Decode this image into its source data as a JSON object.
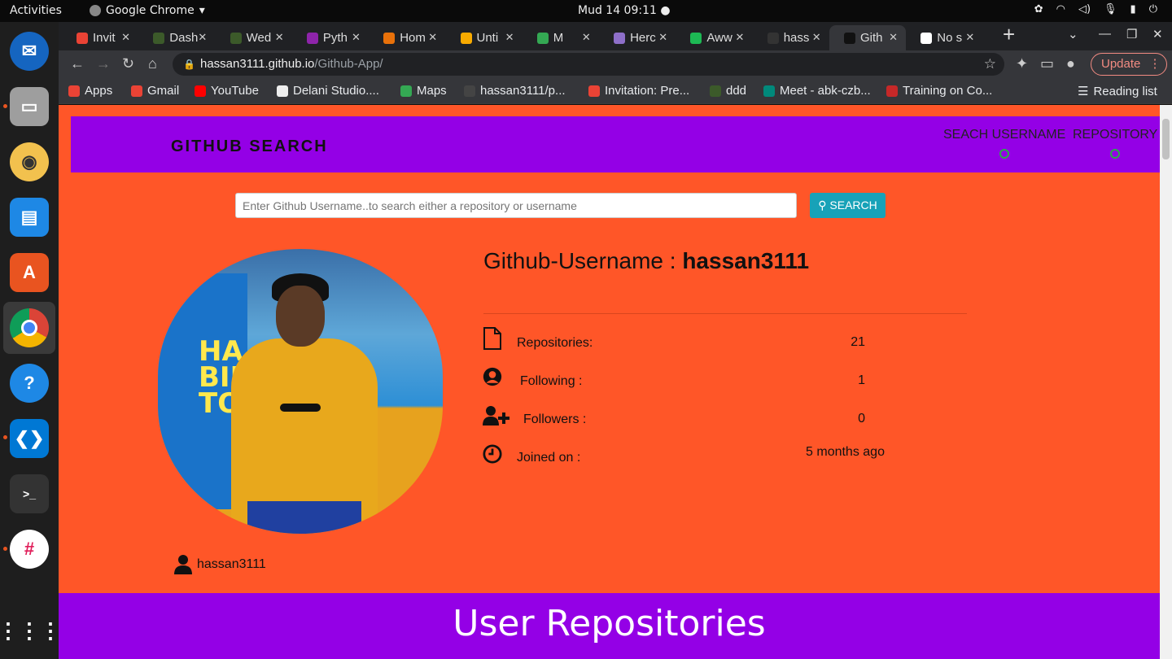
{
  "os": {
    "activities": "Activities",
    "app_name": "Google Chrome",
    "clock": "Mud 14  09:11"
  },
  "browser": {
    "tabs": [
      {
        "label": "Invit",
        "color": "#ea4335"
      },
      {
        "label": "Dash",
        "color": "#3c5a2a"
      },
      {
        "label": "Wed",
        "color": "#3c5a2a"
      },
      {
        "label": "Pyth",
        "color": "#8e24aa"
      },
      {
        "label": "Hom",
        "color": "#e8710a"
      },
      {
        "label": "Unti",
        "color": "#f9ab00"
      },
      {
        "label": "M",
        "color": "#34a853"
      },
      {
        "label": "Herc",
        "color": "#8e6fc9"
      },
      {
        "label": "Aww",
        "color": "#1db954"
      },
      {
        "label": "hass",
        "color": "#333333"
      },
      {
        "label": "Gith",
        "color": "#111111"
      },
      {
        "label": "No s",
        "color": "#ffffff"
      }
    ],
    "url_host": "hassan3111.github.io",
    "url_path": "/Github-App/",
    "update_label": "Update",
    "bookmarks": [
      {
        "label": "Apps",
        "color": "#ea4335"
      },
      {
        "label": "Gmail",
        "color": "#ea4335"
      },
      {
        "label": "YouTube",
        "color": "#ff0000"
      },
      {
        "label": "Delani Studio....",
        "color": "#eeeeee"
      },
      {
        "label": "Maps",
        "color": "#34a853"
      },
      {
        "label": "hassan3111/p...",
        "color": "#444444"
      },
      {
        "label": "Invitation: Pre...",
        "color": "#ea4335"
      },
      {
        "label": "ddd",
        "color": "#3c5a2a"
      },
      {
        "label": "Meet - abk-czb...",
        "color": "#00897b"
      },
      {
        "label": "Training on Co...",
        "color": "#c62828"
      }
    ],
    "reading_list": "Reading list"
  },
  "page": {
    "brand": "GITHUB SEARCH",
    "nav_username": "SEACH USERNAME",
    "nav_repository": "REPOSITORY",
    "search_placeholder": "Enter Github Username..to search either a repository or username",
    "search_button": "SEARCH",
    "title_prefix": "Github-Username : ",
    "username": "hassan3111",
    "stats": [
      {
        "label": "Repositories:",
        "value": "21",
        "icon": "file-icon"
      },
      {
        "label": "Following :",
        "value": "1",
        "icon": "user-circle-icon"
      },
      {
        "label": "Followers :",
        "value": "0",
        "icon": "user-plus-icon"
      },
      {
        "label": "Joined on :",
        "value": "5 months ago",
        "icon": "clock-icon"
      }
    ],
    "avatar_caption": "hassan3111",
    "section_heading": "User Repositories"
  }
}
